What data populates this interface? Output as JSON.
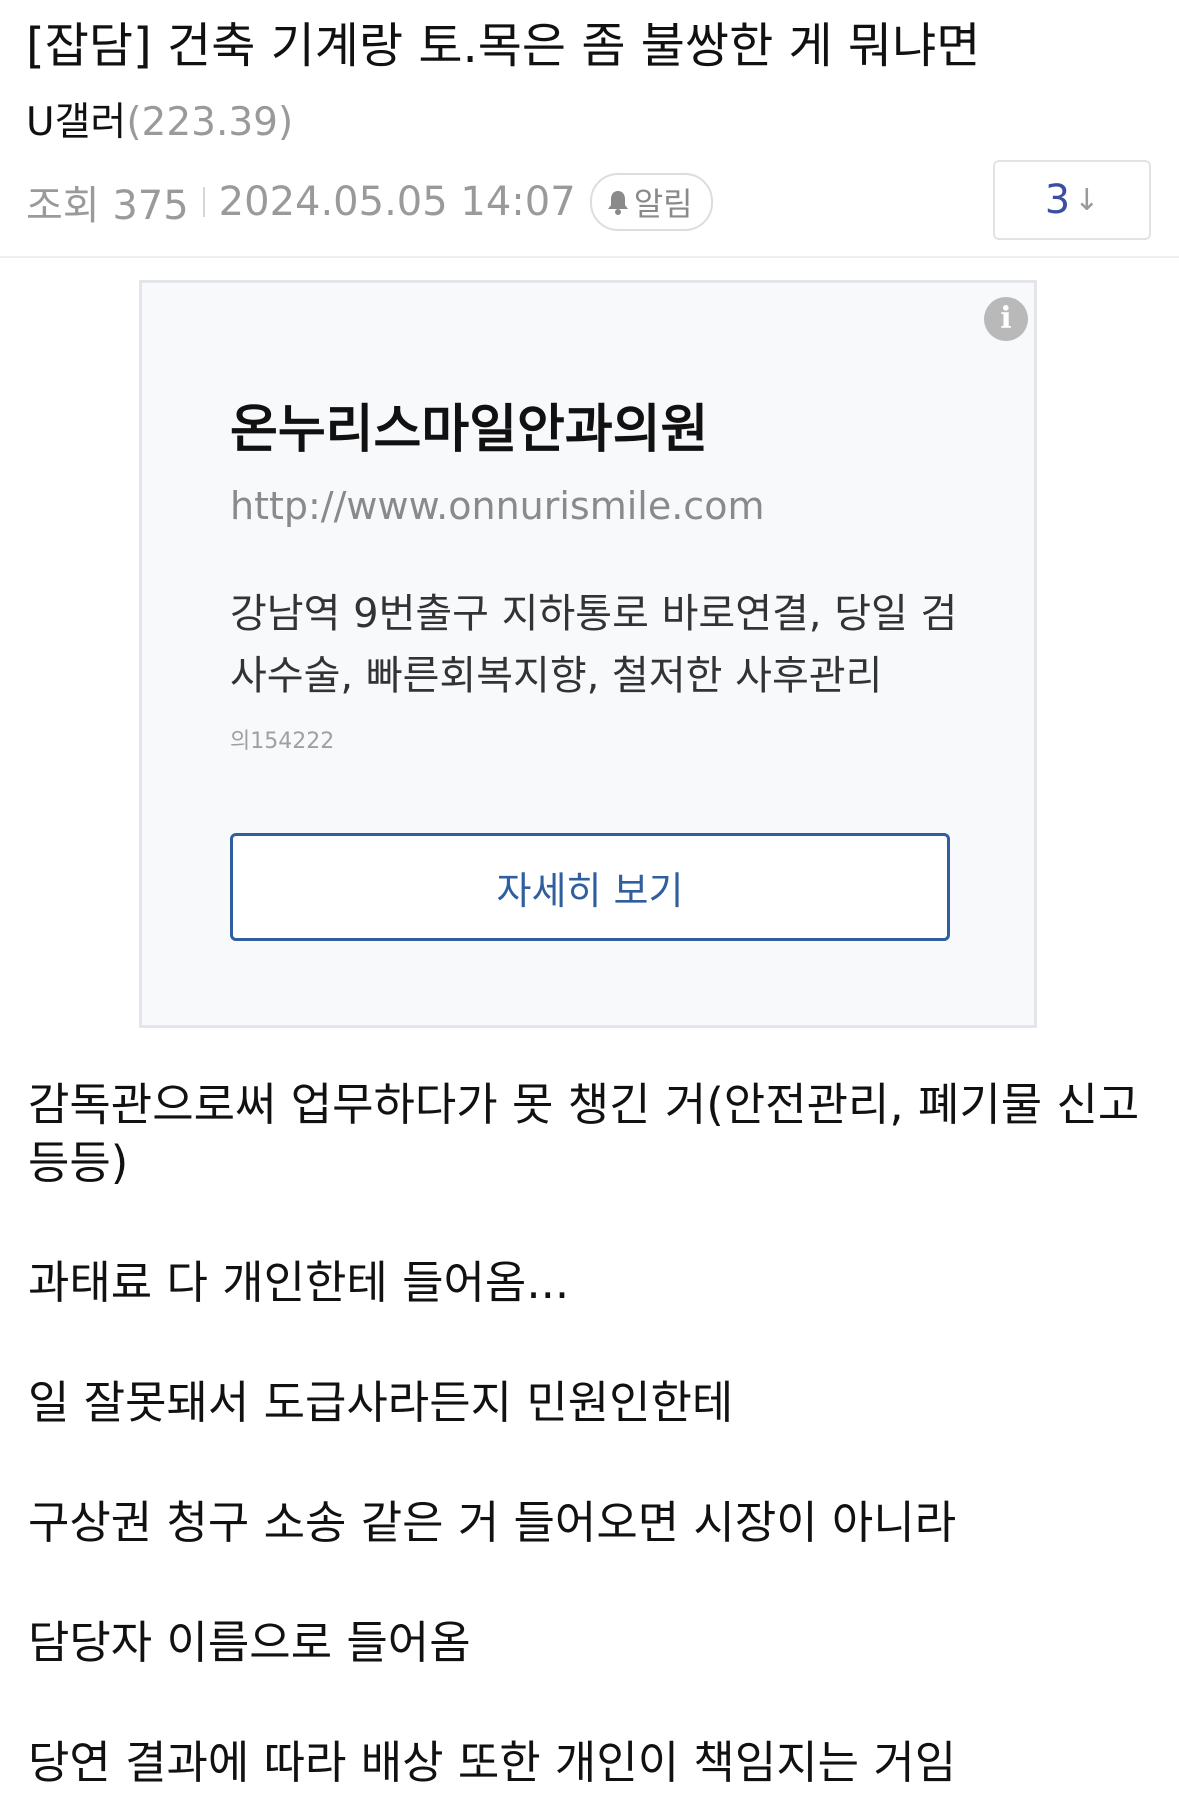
{
  "post": {
    "title": "[잡담] 건축 기계랑 토.목은 좀 불쌍한 게 뭐냐면",
    "author_name": "U갤러",
    "author_ip": "(223.39)",
    "views": "조회 375",
    "datetime": "2024.05.05 14:07",
    "alarm_label": "알림",
    "recommend_count": "3",
    "recommend_arrow": "↓"
  },
  "ad": {
    "info_label": "i",
    "title": "온누리스마일안과의원",
    "url": "http://www.onnurismile.com",
    "description": "강남역 9번출구 지하통로 바로연결, 당일 검사수술, 빠른회복지향, 철저한 사후관리",
    "code": "의154222",
    "cta_label": "자세히 보기"
  },
  "content": {
    "paragraphs": [
      "감독관으로써 업무하다가 못 챙긴 거(안전관리, 폐기물 신고 등등)",
      "과태료 다 개인한테 들어옴...",
      "일 잘못돼서 도급사라든지 민원인한테",
      "구상권 청구 소송 같은 거 들어오면 시장이 아니라",
      "담당자 이름으로 들어옴",
      "당연 결과에 따라 배상 또한 개인이 책임지는 거임"
    ]
  }
}
